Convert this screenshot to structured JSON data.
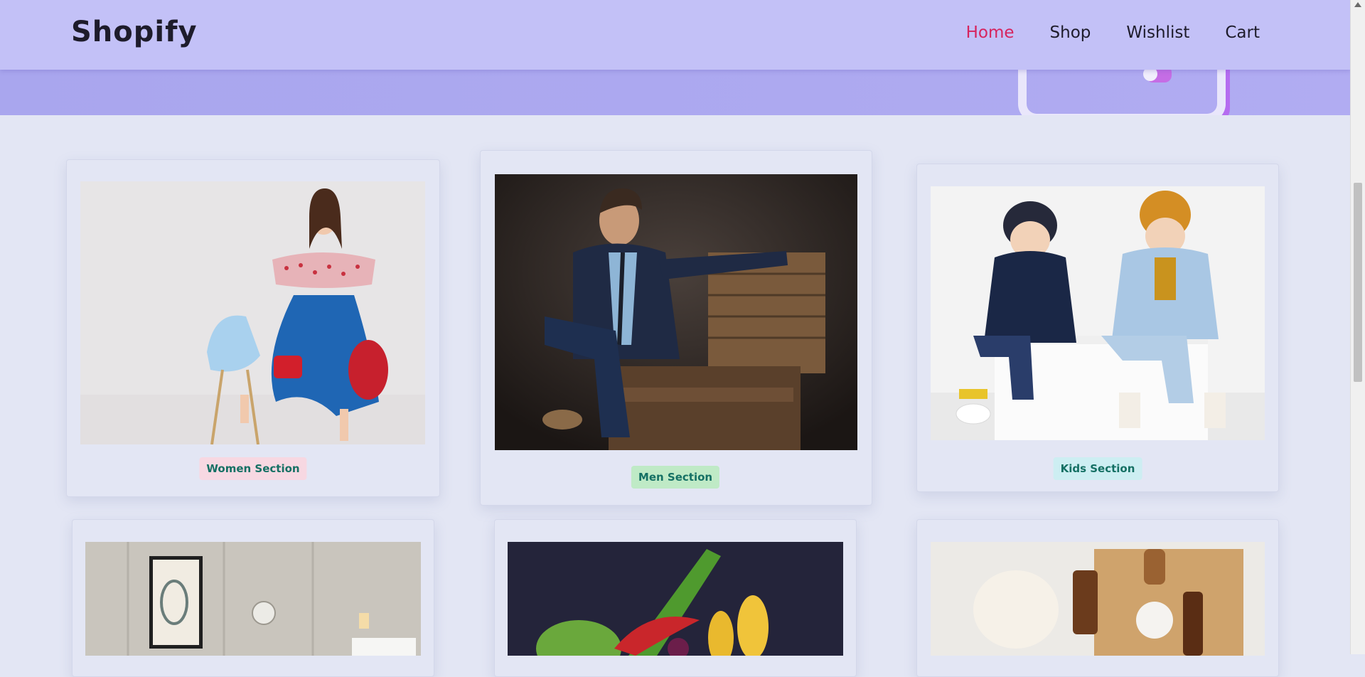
{
  "header": {
    "brand": "Shopify",
    "nav": [
      {
        "label": "Home",
        "active": true
      },
      {
        "label": "Shop",
        "active": false
      },
      {
        "label": "Wishlist",
        "active": false
      },
      {
        "label": "Cart",
        "active": false
      }
    ]
  },
  "sections": [
    {
      "label": "Women Section"
    },
    {
      "label": "Men Section"
    },
    {
      "label": "Kids Section"
    }
  ],
  "colors": {
    "nav_bg": "#c3c1f7",
    "active_link": "#d6245e",
    "page_bg": "#e3e6f4",
    "section_text": "#157064"
  }
}
